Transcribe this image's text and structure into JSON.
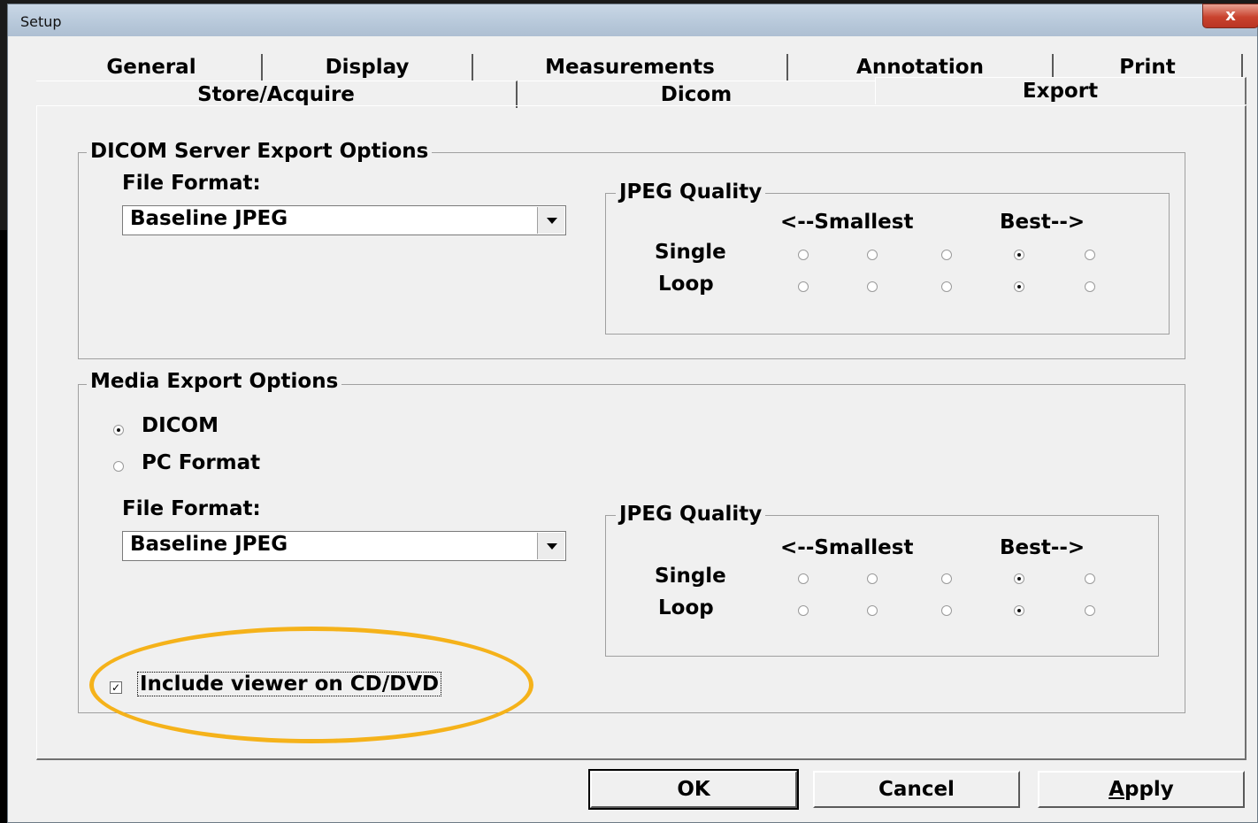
{
  "window": {
    "title": "Setup",
    "close_glyph": "x"
  },
  "tabs_row1": [
    {
      "label": "General"
    },
    {
      "label": "Display"
    },
    {
      "label": "Measurements"
    },
    {
      "label": "Annotation"
    },
    {
      "label": "Print"
    }
  ],
  "tabs_row2": [
    {
      "label": "Store/Acquire"
    },
    {
      "label": "Dicom"
    },
    {
      "label": "Export"
    }
  ],
  "selected_tab": "Export",
  "dicom_server": {
    "group_label": "DICOM Server Export Options",
    "file_format_label": "File Format:",
    "file_format_value": "Baseline JPEG",
    "jpeg_quality": {
      "label": "JPEG Quality",
      "smallest_label": "<--Smallest",
      "best_label": "Best-->",
      "rows": [
        {
          "label": "Single",
          "selected_index": 3
        },
        {
          "label": "Loop",
          "selected_index": 3
        }
      ]
    }
  },
  "media_export": {
    "group_label": "Media Export Options",
    "options": [
      {
        "label": "DICOM",
        "selected": true
      },
      {
        "label": "PC Format",
        "selected": false
      }
    ],
    "file_format_label": "File Format:",
    "file_format_value": "Baseline JPEG",
    "jpeg_quality": {
      "label": "JPEG Quality",
      "smallest_label": "<--Smallest",
      "best_label": "Best-->",
      "rows": [
        {
          "label": "Single",
          "selected_index": 3
        },
        {
          "label": "Loop",
          "selected_index": 3
        }
      ]
    },
    "include_viewer": {
      "label": "Include viewer on CD/DVD",
      "checked": true
    }
  },
  "buttons": {
    "ok": "OK",
    "cancel": "Cancel",
    "apply_underlined": "A",
    "apply_rest": "pply"
  },
  "colors": {
    "highlight_ellipse": "#f5b21a",
    "close_button": "#c9432e"
  }
}
